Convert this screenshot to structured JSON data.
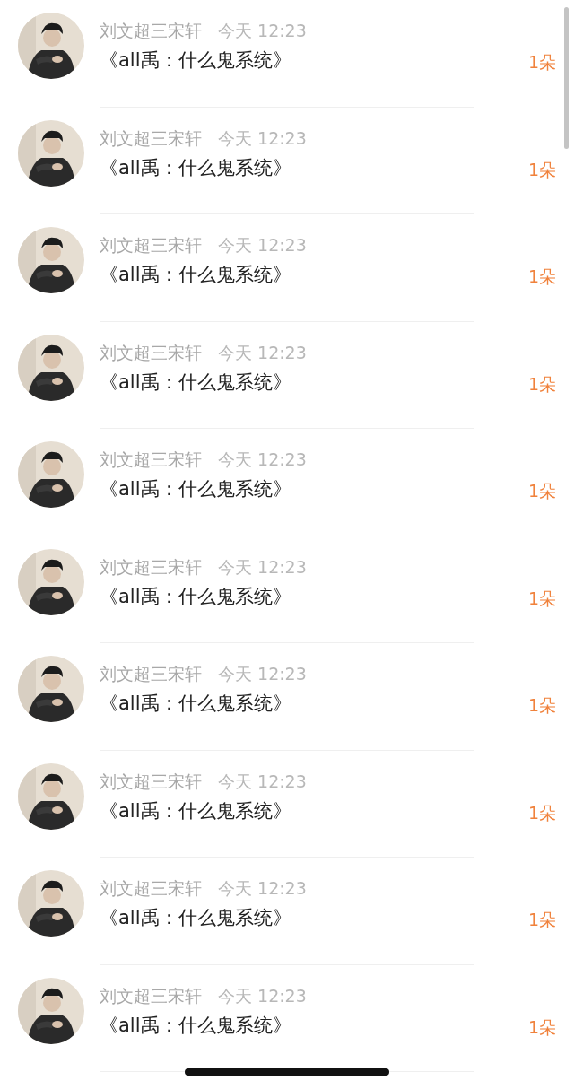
{
  "messages": [
    {
      "sender": "刘文超三宋轩",
      "time": "今天 12:23",
      "title": "《all禹：什么鬼系统》",
      "count": "1朵"
    },
    {
      "sender": "刘文超三宋轩",
      "time": "今天 12:23",
      "title": "《all禹：什么鬼系统》",
      "count": "1朵"
    },
    {
      "sender": "刘文超三宋轩",
      "time": "今天 12:23",
      "title": "《all禹：什么鬼系统》",
      "count": "1朵"
    },
    {
      "sender": "刘文超三宋轩",
      "time": "今天 12:23",
      "title": "《all禹：什么鬼系统》",
      "count": "1朵"
    },
    {
      "sender": "刘文超三宋轩",
      "time": "今天 12:23",
      "title": "《all禹：什么鬼系统》",
      "count": "1朵"
    },
    {
      "sender": "刘文超三宋轩",
      "time": "今天 12:23",
      "title": "《all禹：什么鬼系统》",
      "count": "1朵"
    },
    {
      "sender": "刘文超三宋轩",
      "time": "今天 12:23",
      "title": "《all禹：什么鬼系统》",
      "count": "1朵"
    },
    {
      "sender": "刘文超三宋轩",
      "time": "今天 12:23",
      "title": "《all禹：什么鬼系统》",
      "count": "1朵"
    },
    {
      "sender": "刘文超三宋轩",
      "time": "今天 12:23",
      "title": "《all禹：什么鬼系统》",
      "count": "1朵"
    },
    {
      "sender": "刘文超三宋轩",
      "time": "今天 12:23",
      "title": "《all禹：什么鬼系统》",
      "count": "1朵"
    }
  ]
}
